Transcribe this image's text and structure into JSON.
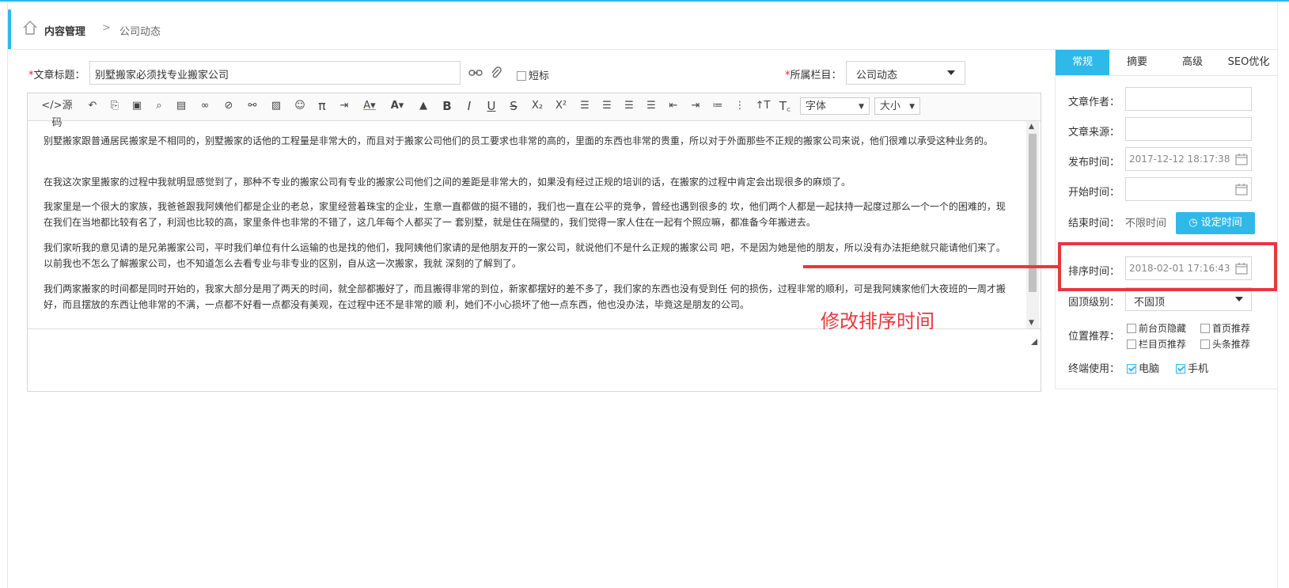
{
  "breadcrumb": {
    "home": "内容管理",
    "current": "公司动态"
  },
  "form": {
    "title_label": "文章标题：",
    "title_value": "别墅搬家必须找专业搬家公司",
    "short_title": "短标",
    "column_label": "所属栏目：",
    "column_value": "公司动态",
    "required_mark": "*"
  },
  "toolbar": {
    "source": "源码",
    "font_select": "字体",
    "size_select": "大小",
    "icons": [
      "undo",
      "copy",
      "paste",
      "preview",
      "template",
      "link",
      "unlink",
      "anchor",
      "image",
      "emoticon",
      "formula",
      "indent-line",
      "font-color",
      "bg-color",
      "clear-format",
      "bold",
      "italic",
      "underline",
      "strikethrough",
      "subscript",
      "superscript",
      "align-left",
      "align-center",
      "align-right",
      "justify",
      "indent",
      "outdent",
      "ordered-list",
      "unordered-list",
      "text-direction",
      "clear-text"
    ]
  },
  "content": {
    "paragraphs": [
      "别墅搬家跟普通居民搬家是不相同的，别墅搬家的话他的工程量是非常大的，而且对于搬家公司他们的员工要求也非常的高的，里面的东西也非常的贵重，所以对于外面那些不正规的搬家公司来说，他们很难以承受这种业务的。",
      "在我这次家里搬家的过程中我就明显感觉到了，那种不专业的搬家公司有专业的搬家公司他们之间的差距是非常大的，如果没有经过正规的培训的话，在搬家的过程中肯定会出现很多的麻烦了。",
      "我家里是一个很大的家族，我爸爸跟我阿姨他们都是企业的老总，家里经营着珠宝的企业，生意一直都做的挺不错的，我们也一直在公平的竞争，曾经也遇到很多的  坎，他们两个人都是一起扶持一起度过那么一个一个的困难的，现在我们在当地都比较有名了，利润也比较的高，家里条件也非常的不错了，这几年每个人都买了一  套别墅，就是住在隔壁的，我们觉得一家人住在一起有个照应嘛，都准备今年搬进去。",
      "我们家听我的意见请的是兄弟搬家公司，平时我们单位有什么运输的也是找的他们，我阿姨他们家请的是他朋友开的一家公司，就说他们不是什么正规的搬家公司  吧，不是因为她是他的朋友，所以没有办法拒绝就只能请他们来了。以前我也不怎么了解搬家公司，也不知道怎么去看专业与非专业的区别，自从这一次搬家，我就  深刻的了解到了。",
      "我们两家搬家的时间都是同时开始的，我家大部分是用了两天的时间，就全部都搬好了，而且搬得非常的到位，新家都摆好的差不多了，我们家的东西也没有受到任  何的损伤，过程非常的顺利，可是我阿姨家他们大夜班的一周才搬好，而且摆放的东西让他非常的不满，一点都不好看一点都没有美观，在过程中还不是非常的顺  利，她们不小心损坏了他一点东西，他也没办法，毕竟这是朋友的公司。"
    ]
  },
  "panel": {
    "tabs": [
      "常规",
      "摘要",
      "高级",
      "SEO优化"
    ],
    "author_label": "文章作者：",
    "author_value": "",
    "source_label": "文章来源：",
    "source_value": "",
    "publish_label": "发布时间：",
    "publish_value": "2017-12-12 18:17:38",
    "start_label": "开始时间：",
    "start_value": "",
    "end_label": "结束时间：",
    "end_value": "不限时间",
    "set_time_button": "设定时间",
    "sort_label": "排序时间：",
    "sort_value": "2018-02-01 17:16:43",
    "top_label": "固顶级别：",
    "top_value": "不固顶",
    "position_label": "位置推荐：",
    "position_options": [
      "前台页隐藏",
      "首页推荐",
      "栏目页推荐",
      "头条推荐"
    ],
    "terminal_label": "终端使用：",
    "terminal_options": [
      "电脑",
      "手机"
    ]
  },
  "annotation": {
    "text": "修改排序时间",
    "color": "#e8383d"
  },
  "colors": {
    "accent": "#2fb9e8",
    "annotation": "#e8383d"
  }
}
